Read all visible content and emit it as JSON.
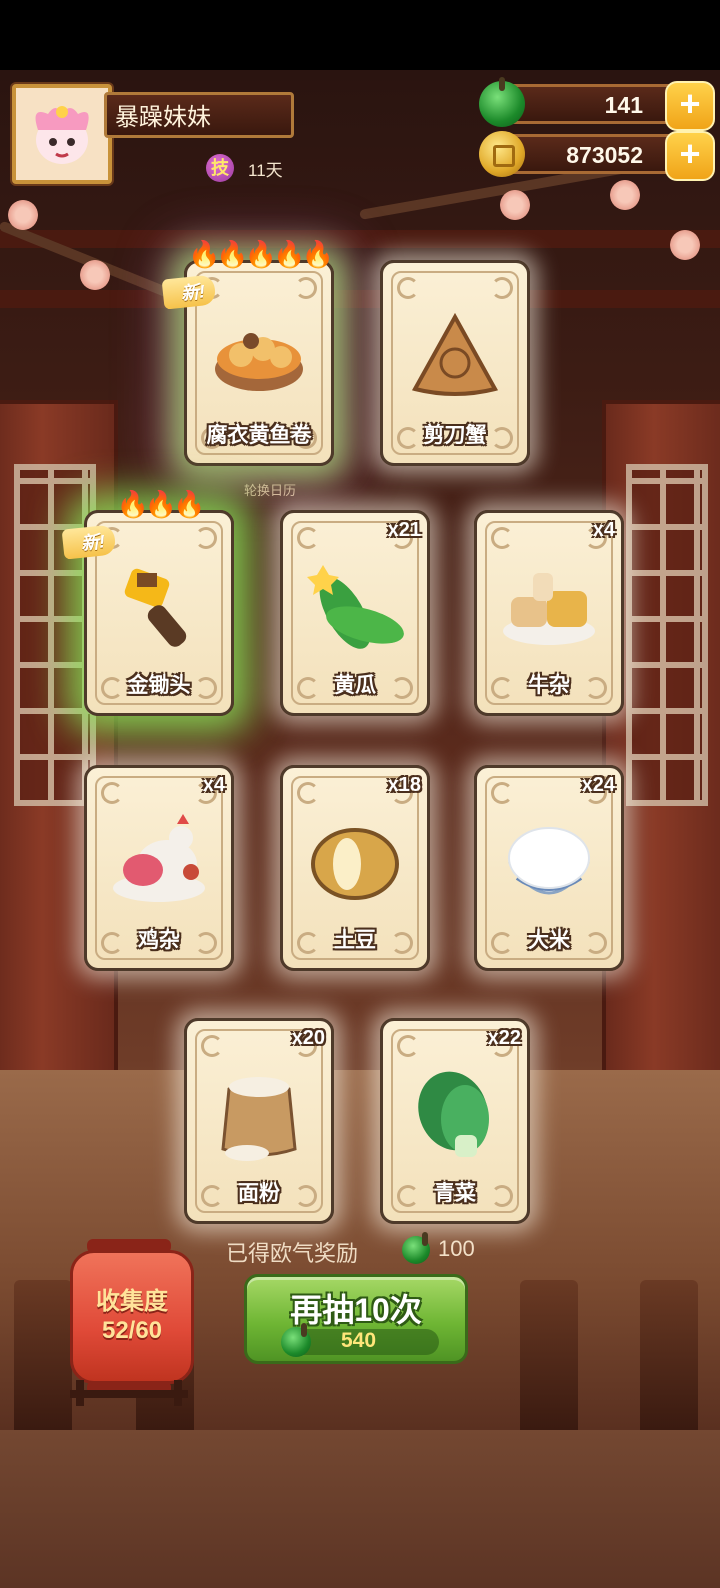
{
  "player": {
    "name": "暴躁妹妹",
    "skill_label": "技",
    "days": "11天"
  },
  "currency": {
    "gems": "141",
    "coins": "873052"
  },
  "caption": "轮换日历",
  "cards": [
    {
      "label": "腐衣黄鱼卷",
      "count": "",
      "flames": "🔥🔥🔥🔥🔥",
      "new": "新!",
      "art": "dish"
    },
    {
      "label": "剪刀蟹",
      "count": "",
      "flames": "",
      "new": "",
      "art": "triangle"
    },
    {
      "label": "金锄头",
      "count": "",
      "flames": "🔥🔥🔥",
      "new": "新!",
      "art": "hammer"
    },
    {
      "label": "黄瓜",
      "count": "x21",
      "flames": "",
      "new": "",
      "art": "cucumber"
    },
    {
      "label": "牛杂",
      "count": "x4",
      "flames": "",
      "new": "",
      "art": "beef"
    },
    {
      "label": "鸡杂",
      "count": "x4",
      "flames": "",
      "new": "",
      "art": "chicken"
    },
    {
      "label": "土豆",
      "count": "x18",
      "flames": "",
      "new": "",
      "art": "potato"
    },
    {
      "label": "大米",
      "count": "x24",
      "flames": "",
      "new": "",
      "art": "rice"
    },
    {
      "label": "面粉",
      "count": "x20",
      "flames": "",
      "new": "",
      "art": "flour"
    },
    {
      "label": "青菜",
      "count": "x22",
      "flames": "",
      "new": "",
      "art": "greens"
    }
  ],
  "collection": {
    "title": "收集度",
    "progress": "52/60"
  },
  "reward": {
    "label": "已得欧气奖励",
    "value": "100"
  },
  "draw_button": {
    "label": "再抽10次",
    "cost": "540"
  },
  "colors": {
    "gem": "#1c8a2a",
    "coin": "#e0a828",
    "button": "#6fb634",
    "lantern": "#e04a38"
  }
}
